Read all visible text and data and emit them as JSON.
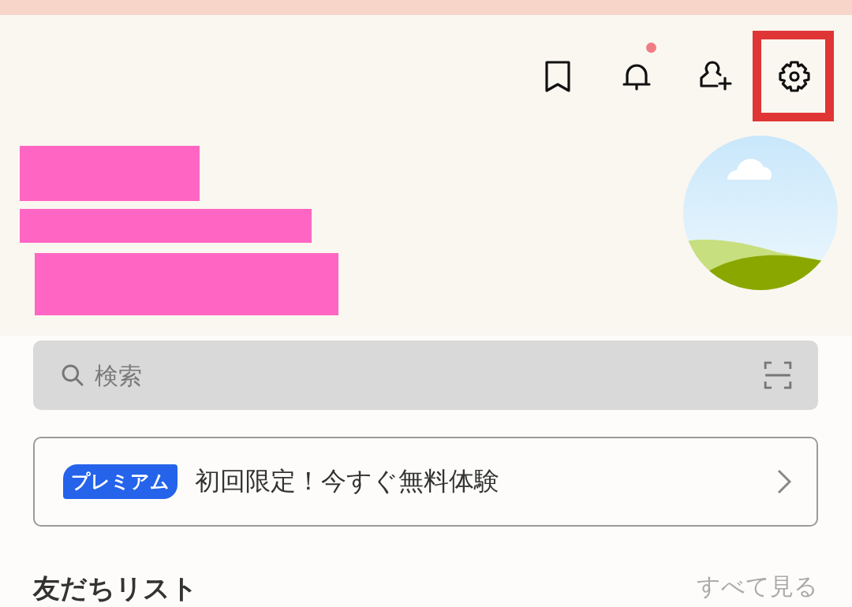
{
  "header_actions": [
    {
      "kind": "bookmark",
      "badge": false,
      "highlighted": false
    },
    {
      "kind": "bell",
      "badge": true,
      "highlighted": false
    },
    {
      "kind": "add-friend",
      "badge": false,
      "highlighted": false
    },
    {
      "kind": "settings",
      "badge": false,
      "highlighted": true
    }
  ],
  "search": {
    "placeholder": "検索"
  },
  "premium_banner": {
    "badge": "プレミアム",
    "text": "初回限定！今すぐ無料体験"
  },
  "friends_section": {
    "title": "友だちリスト",
    "link": "すべて見る"
  }
}
